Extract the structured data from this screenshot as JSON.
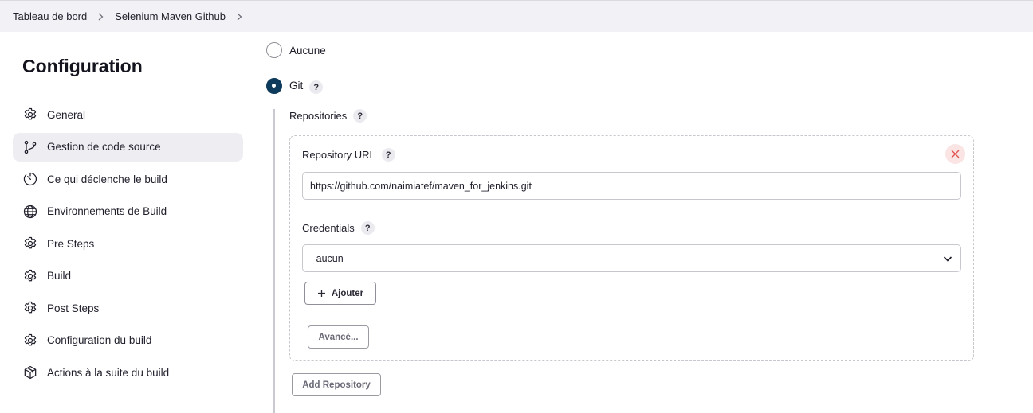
{
  "breadcrumb": {
    "items": [
      "Tableau de bord",
      "Selenium Maven Github"
    ]
  },
  "sidebar": {
    "title": "Configuration",
    "items": [
      {
        "label": "General",
        "icon": "gear-icon",
        "active": false
      },
      {
        "label": "Gestion de code source",
        "icon": "branch-icon",
        "active": true
      },
      {
        "label": "Ce qui déclenche le build",
        "icon": "timer-icon",
        "active": false
      },
      {
        "label": "Environnements de Build",
        "icon": "globe-icon",
        "active": false
      },
      {
        "label": "Pre Steps",
        "icon": "gear-icon",
        "active": false
      },
      {
        "label": "Build",
        "icon": "gear-icon",
        "active": false
      },
      {
        "label": "Post Steps",
        "icon": "gear-icon",
        "active": false
      },
      {
        "label": "Configuration du build",
        "icon": "gear-icon",
        "active": false
      },
      {
        "label": "Actions à la suite du build",
        "icon": "package-icon",
        "active": false
      }
    ]
  },
  "scm": {
    "options": [
      {
        "label": "Aucune",
        "checked": false
      },
      {
        "label": "Git",
        "checked": true
      }
    ],
    "help_glyph": "?",
    "repositories_label": "Repositories",
    "repository_url_label": "Repository URL",
    "repository_url_value": "https://github.com/naimiatef/maven_for_jenkins.git",
    "credentials_label": "Credentials",
    "credentials_value": "- aucun -",
    "add_button": "Ajouter",
    "advanced_button": "Avancé...",
    "add_repository_button": "Add Repository"
  },
  "colors": {
    "accent": "#0e3b5c",
    "active_bg": "#eeedf2",
    "danger_bg": "#fbe4e4",
    "danger": "#e05252"
  }
}
